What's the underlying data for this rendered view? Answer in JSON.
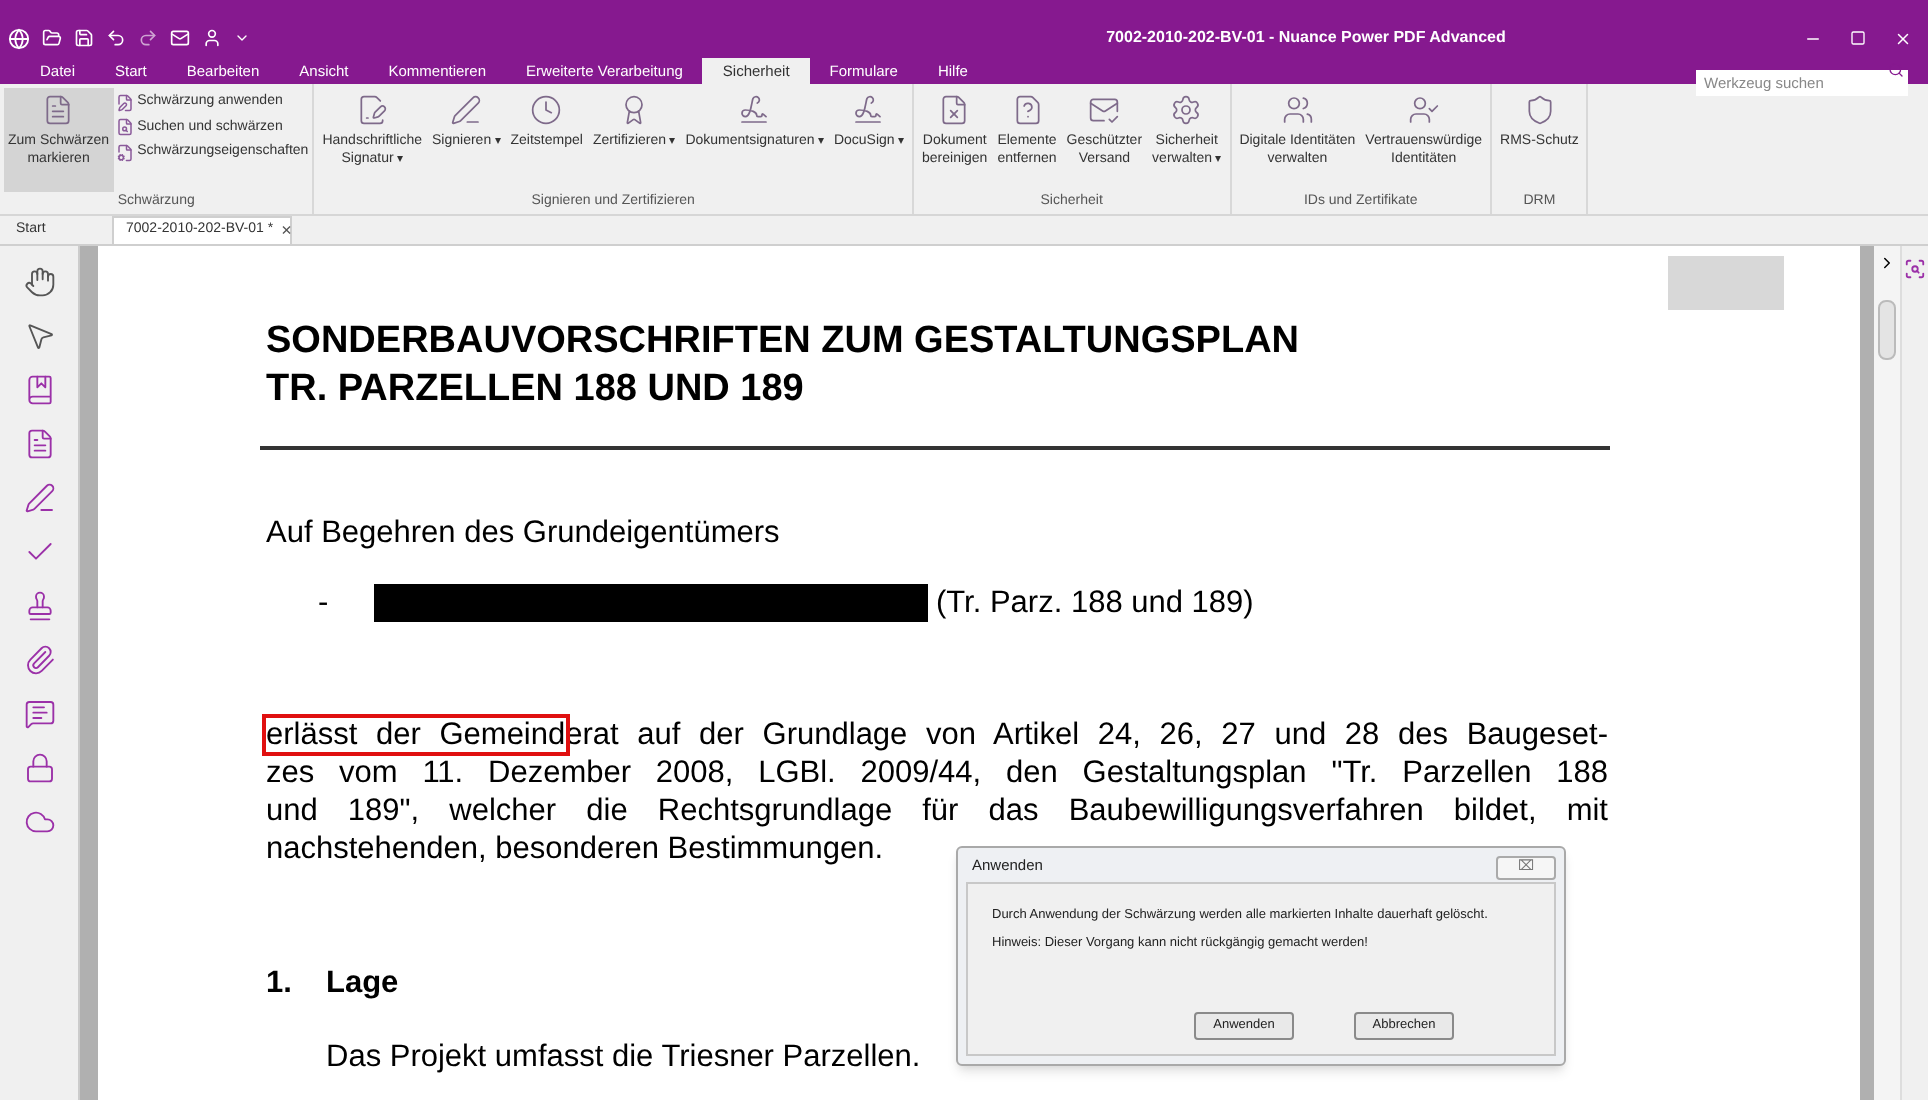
{
  "window": {
    "title": "7002-2010-202-BV-01 - Nuance Power PDF Advanced"
  },
  "menu_tabs": [
    {
      "label": "Datei",
      "selected": false
    },
    {
      "label": "Start",
      "selected": false
    },
    {
      "label": "Bearbeiten",
      "selected": false
    },
    {
      "label": "Ansicht",
      "selected": false
    },
    {
      "label": "Kommentieren",
      "selected": false
    },
    {
      "label": "Erweiterte Verarbeitung",
      "selected": false
    },
    {
      "label": "Sicherheit",
      "selected": true
    },
    {
      "label": "Formulare",
      "selected": false
    },
    {
      "label": "Hilfe",
      "selected": false
    }
  ],
  "search": {
    "placeholder": "Werkzeug suchen"
  },
  "ribbon_groups": [
    {
      "title": "Schwärzung",
      "large": [
        {
          "label": "Zum Schwärzen\nmarkieren",
          "selected": true
        }
      ],
      "small": [
        "Schwärzung anwenden",
        "Suchen und schwärzen",
        "Schwärzungseigenschaften"
      ]
    },
    {
      "title": "Signieren und Zertifizieren",
      "large": [
        {
          "label": "Handschriftliche\nSignatur",
          "caret": "▾",
          "selected": false
        },
        {
          "label": "Signieren",
          "caret": "▾",
          "selected": false
        },
        {
          "label": "Zeitstempel",
          "selected": false
        },
        {
          "label": "Zertifizieren",
          "caret": "▾",
          "selected": false
        },
        {
          "label": "Dokumentsignaturen",
          "caret": "▾",
          "selected": false
        },
        {
          "label": "DocuSign",
          "caret": "▾",
          "selected": false
        }
      ]
    },
    {
      "title": "Sicherheit",
      "large": [
        {
          "label": "Dokument\nbereinigen",
          "selected": false
        },
        {
          "label": "Elemente\nentfernen",
          "selected": false
        },
        {
          "label": "Geschützter\nVersand",
          "selected": false
        },
        {
          "label": "Sicherheit\nverwalten",
          "caret": "▾",
          "selected": false
        }
      ]
    },
    {
      "title": "IDs und Zertifikate",
      "large": [
        {
          "label": "Digitale Identitäten\nverwalten",
          "selected": false
        },
        {
          "label": "Vertrauenswürdige\nIdentitäten",
          "selected": false
        }
      ]
    },
    {
      "title": "DRM",
      "large": [
        {
          "label": "RMS-Schutz",
          "selected": false
        }
      ]
    }
  ],
  "doc_tabs": [
    {
      "label": "Start",
      "selected": false
    },
    {
      "label": "7002-2010-202-BV-01 *",
      "selected": true,
      "close": "×"
    }
  ],
  "document": {
    "title_lines": [
      "SONDERBAUVORSCHRIFTEN ZUM GESTALTUNGSPLAN",
      "TR. PARZELLEN 188 UND 189"
    ],
    "intro": "Auf Begehren des Grundeigentümers",
    "bullet": {
      "marker": "-",
      "redacted": true,
      "text": "(Tr. Parz. 188 und 189)"
    },
    "paragraph": {
      "marked": "erlässt der Gemeind",
      "lines": [
        "erat auf der Grundlage von Artikel 24, 26, 27 und 28 des Baugeset-",
        "zes vom 11. Dezember 2008, LGBl. 2009/44, den Gestaltungsplan \"Tr. Parzellen 188",
        "und 189\", welcher die Rechtsgrundlage für das Baubewilligungsverfahren bildet, mit",
        "nachstehenden, besonderen Bestimmungen."
      ]
    },
    "section": {
      "number": "1.",
      "title": "Lage"
    },
    "section_text": "Das Projekt umfasst die Triesner Parzellen."
  },
  "dialog": {
    "title": "Anwenden",
    "close": "⌧",
    "lines": [
      "Durch Anwendung der Schwärzung werden alle markierten Inhalte dauerhaft gelöscht.",
      "Hinweis: Dieser Vorgang kann nicht rückgängig gemacht werden!"
    ],
    "buttons": [
      "Anwenden",
      "Abbrechen"
    ]
  }
}
